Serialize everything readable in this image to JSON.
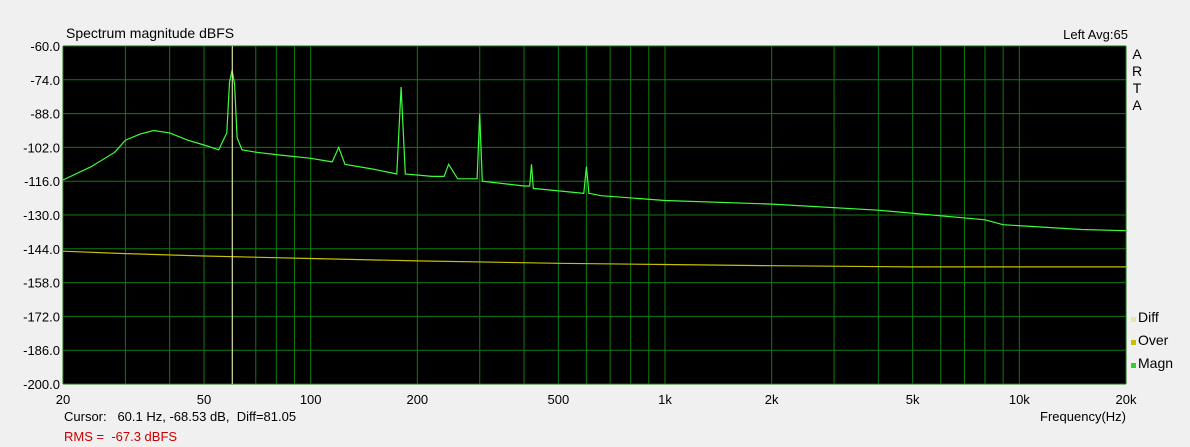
{
  "header": {
    "title": "Spectrum magnitude dBFS",
    "status": "Left  Avg:65"
  },
  "brand": [
    "A",
    "R",
    "T",
    "A"
  ],
  "legend": [
    {
      "label": "Diff",
      "color": "#e8e8a0"
    },
    {
      "label": "Over",
      "color": "#c8c000"
    },
    {
      "label": "Magn",
      "color": "#2bd62b"
    }
  ],
  "footer": {
    "cursor": "Cursor:   60.1 Hz, -68.53 dB,  Diff=81.05",
    "rms": "RMS =  -67.3 dBFS",
    "rms_color": "#cc0000"
  },
  "colors": {
    "plot_bg": "#000000",
    "grid": "#0f7a0f",
    "magn": "#3cff3c",
    "over": "#c8c000",
    "cursor_line": "#f0f0b0"
  },
  "chart_data": {
    "type": "line",
    "xlabel": "Frequency(Hz)",
    "ylabel": "",
    "x_scale": "log",
    "xlim": [
      20,
      20000
    ],
    "ylim": [
      -200,
      -60
    ],
    "y_ticks": [
      "-60.0",
      "-74.0",
      "-88.0",
      "-102.0",
      "-116.0",
      "-130.0",
      "-144.0",
      "-158.0",
      "-172.0",
      "-186.0",
      "-200.0"
    ],
    "x_ticks": [
      {
        "value": 20,
        "label": "20"
      },
      {
        "value": 50,
        "label": "50"
      },
      {
        "value": 100,
        "label": "100"
      },
      {
        "value": 200,
        "label": "200"
      },
      {
        "value": 500,
        "label": "500"
      },
      {
        "value": 1000,
        "label": "1k"
      },
      {
        "value": 2000,
        "label": "2k"
      },
      {
        "value": 5000,
        "label": "5k"
      },
      {
        "value": 10000,
        "label": "10k"
      },
      {
        "value": 20000,
        "label": "20k"
      }
    ],
    "cursor_x": 60.1,
    "grid": true,
    "series": [
      {
        "name": "Magn",
        "x": [
          20,
          24,
          28,
          30,
          33,
          36,
          40,
          45,
          50,
          55,
          58,
          59,
          60,
          61,
          62,
          64,
          70,
          80,
          100,
          115,
          120,
          125,
          150,
          175,
          180,
          185,
          220,
          238,
          245,
          260,
          295,
          300,
          305,
          400,
          415,
          420,
          425,
          590,
          600,
          610,
          660,
          1000,
          2000,
          4000,
          8000,
          9000,
          15000,
          20000
        ],
        "y": [
          -115.5,
          -110,
          -104,
          -99,
          -96.5,
          -95,
          -96,
          -99,
          -101,
          -103,
          -96,
          -75,
          -70,
          -76,
          -98,
          -103,
          -104,
          -105,
          -106.5,
          -108,
          -102,
          -109,
          -111,
          -113,
          -77,
          -113,
          -114,
          -114,
          -109,
          -115,
          -115,
          -88,
          -116,
          -118,
          -118,
          -109,
          -119,
          -121,
          -110,
          -121,
          -122,
          -124,
          -125.5,
          -128,
          -132,
          -134,
          -136,
          -136.5
        ],
        "color": "#3cff3c"
      },
      {
        "name": "Over",
        "x": [
          20,
          30,
          50,
          100,
          200,
          500,
          1000,
          2000,
          5000,
          10000,
          20000
        ],
        "y": [
          -145,
          -146,
          -147,
          -148,
          -149,
          -150,
          -150.5,
          -151,
          -151.5,
          -151.5,
          -151.5
        ],
        "color": "#c8c000"
      }
    ]
  }
}
